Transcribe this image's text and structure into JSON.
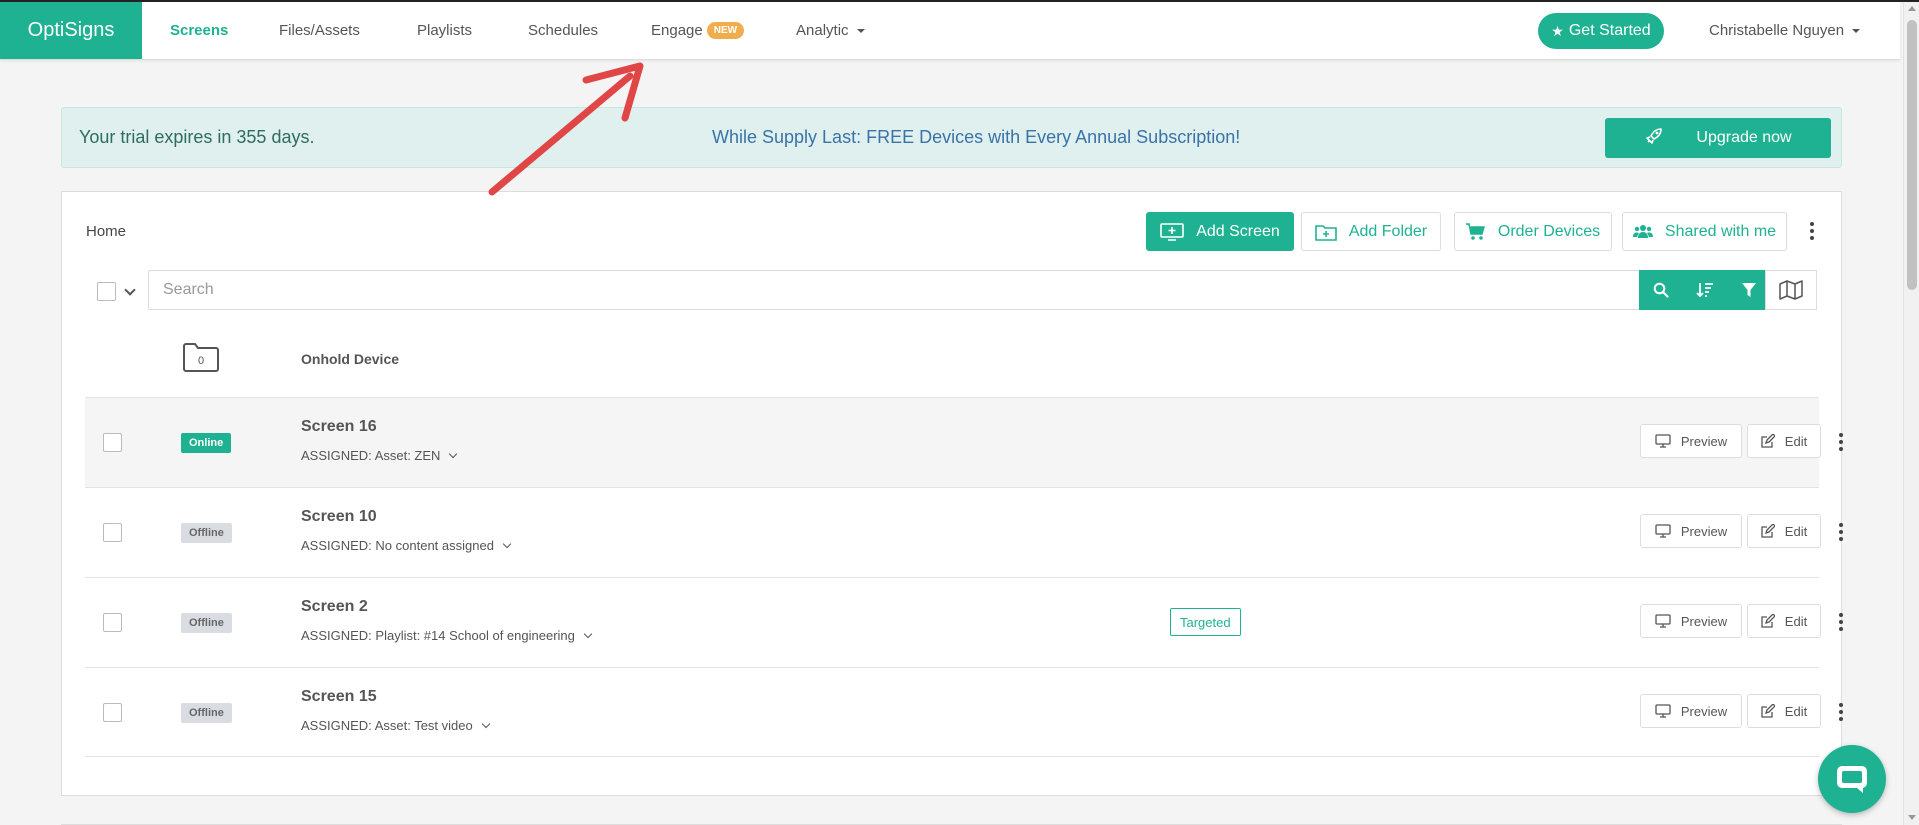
{
  "nav": {
    "logo": "OptiSigns",
    "links": [
      {
        "label": "Screens",
        "active": true
      },
      {
        "label": "Files/Assets"
      },
      {
        "label": "Playlists"
      },
      {
        "label": "Schedules"
      },
      {
        "label": "Engage",
        "badge": "NEW"
      },
      {
        "label": "Analytic"
      }
    ],
    "get_started": "Get Started",
    "user": "Christabelle Nguyen"
  },
  "banner": {
    "trial": "Your trial expires in 355 days.",
    "promo": "While Supply Last: FREE Devices with Every Annual Subscription!",
    "upgrade": "Upgrade now"
  },
  "toolbar": {
    "breadcrumb": "Home",
    "add_screen": "Add Screen",
    "add_folder": "Add Folder",
    "order_devices": "Order Devices",
    "shared": "Shared with me"
  },
  "search": {
    "placeholder": "Search"
  },
  "folder": {
    "count": "0",
    "label": "Onhold Device"
  },
  "screens": [
    {
      "name": "Screen 16",
      "status": "Online",
      "assigned": "ASSIGNED: Asset: ZEN",
      "tag": ""
    },
    {
      "name": "Screen 10",
      "status": "Offline",
      "assigned": "ASSIGNED: No content assigned",
      "tag": ""
    },
    {
      "name": "Screen 2",
      "status": "Offline",
      "assigned": "ASSIGNED: Playlist: #14 School of engineering",
      "tag": "Targeted"
    },
    {
      "name": "Screen 15",
      "status": "Offline",
      "assigned": "ASSIGNED: Asset: Test video",
      "tag": ""
    }
  ],
  "row_actions": {
    "preview": "Preview",
    "edit": "Edit"
  },
  "colors": {
    "accent": "#1fb292",
    "badge": "#f0ad4e",
    "promo": "#3a73a8",
    "arrow": "#e04646"
  }
}
